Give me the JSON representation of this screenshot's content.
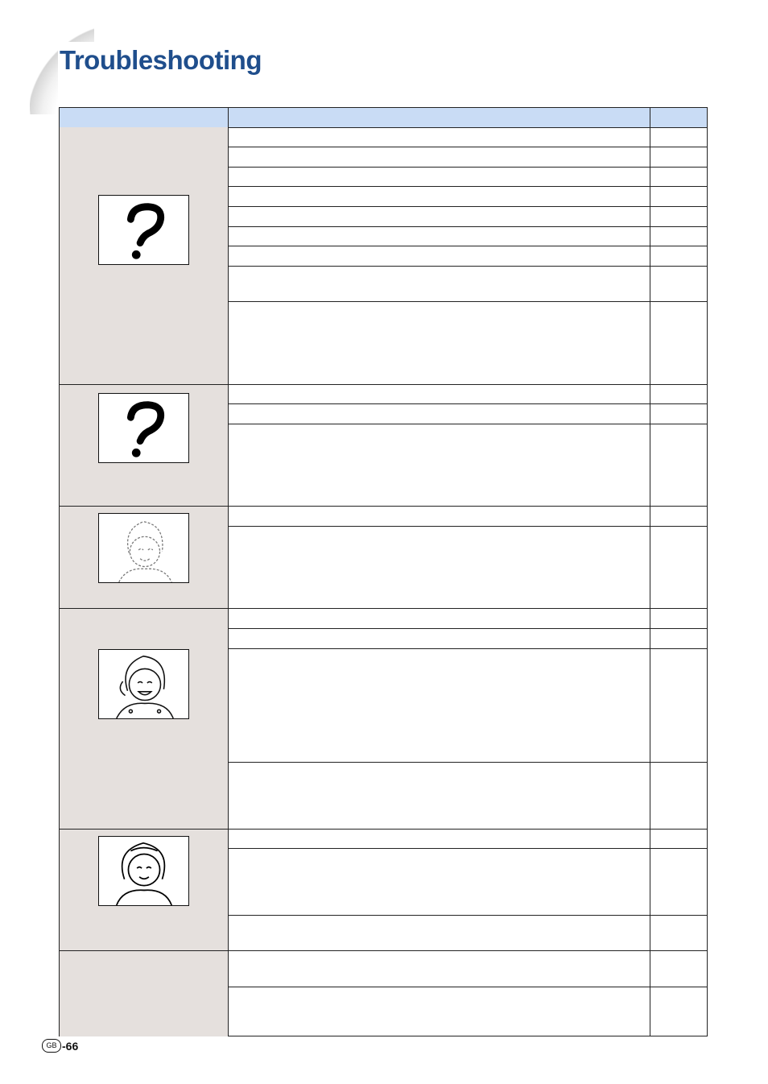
{
  "page": {
    "title": "Troubleshooting"
  },
  "footer": {
    "region_badge": "GB",
    "page_number": "-66"
  },
  "colors": {
    "title": "#1f4e8c",
    "header_fill": "#c9dcf5",
    "problem_column_fill": "#e5e0dd"
  },
  "groups": [
    {
      "icon": "question-mark-icon"
    },
    {
      "icon": "question-mark-icon"
    },
    {
      "icon": "faint-face-icon"
    },
    {
      "icon": "blurry-face-icon"
    },
    {
      "icon": "clear-face-icon"
    },
    {
      "icon": ""
    }
  ]
}
